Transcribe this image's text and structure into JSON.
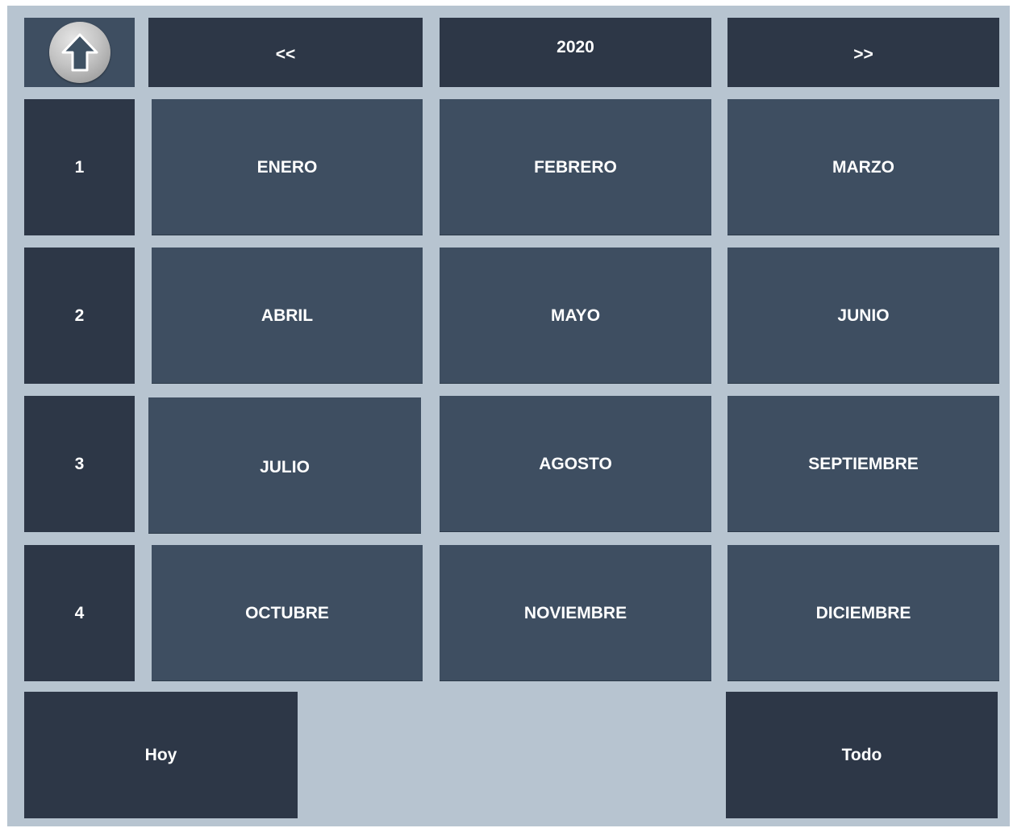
{
  "header": {
    "up_icon": "arrow-up-icon",
    "prev_label": "<<",
    "year_label": "2020",
    "next_label": ">>"
  },
  "quarters": [
    "1",
    "2",
    "3",
    "4"
  ],
  "months": [
    "ENERO",
    "FEBRERO",
    "MARZO",
    "ABRIL",
    "MAYO",
    "JUNIO",
    "JULIO",
    "AGOSTO",
    "SEPTIEMBRE",
    "OCTUBRE",
    "NOVIEMBRE",
    "DICIEMBRE"
  ],
  "footer": {
    "today_label": "Hoy",
    "all_label": "Todo"
  },
  "colors": {
    "panel": "#b7c4d0",
    "dark_tile": "#2d3747",
    "month_tile": "#3e4e61",
    "text": "#ffffff"
  }
}
